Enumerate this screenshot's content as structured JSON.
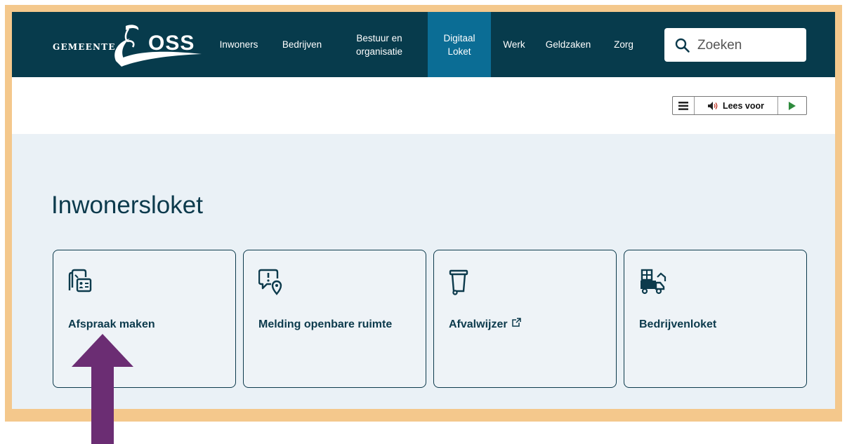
{
  "header": {
    "logo": {
      "line1": "GEMEENTE",
      "line2": "OSS"
    },
    "nav": [
      {
        "label": "Inwoners",
        "active": false
      },
      {
        "label": "Bedrijven",
        "active": false
      },
      {
        "label": "Bestuur en\norganisatie",
        "active": false
      },
      {
        "label": "Digitaal\nLoket",
        "active": true
      },
      {
        "label": "Werk",
        "active": false
      },
      {
        "label": "Geldzaken",
        "active": false
      },
      {
        "label": "Zorg",
        "active": false
      }
    ],
    "search": {
      "placeholder": "Zoeken",
      "icon": "search-icon"
    }
  },
  "readspeaker": {
    "label": "Lees voor",
    "icons": [
      "menu-icon",
      "speaker-icon",
      "play-icon"
    ]
  },
  "main": {
    "title": "Inwonersloket",
    "cards": [
      {
        "label": "Afspraak maken",
        "icon": "appointment-icon"
      },
      {
        "label": "Melding openbare ruimte",
        "icon": "report-location-icon"
      },
      {
        "label": "Afvalwijzer",
        "icon": "waste-bin-icon",
        "external": true
      },
      {
        "label": "Bedrijvenloket",
        "icon": "business-icon"
      }
    ]
  },
  "colors": {
    "header_bg": "#073b4c",
    "active_nav": "#0b6d95",
    "page_bg": "#eaf1f6",
    "text_dark": "#0c3a4c",
    "frame": "#f4c88c",
    "annotation_arrow": "#6b2d73"
  }
}
